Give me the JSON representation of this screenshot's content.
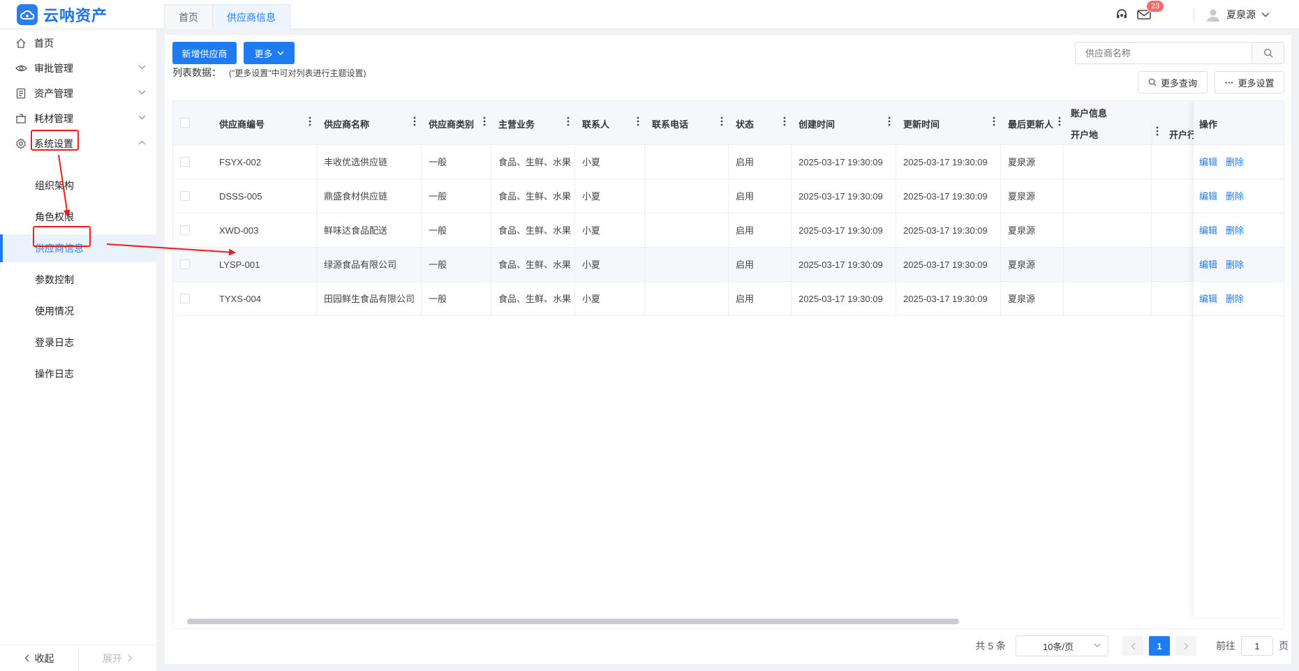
{
  "app": {
    "name": "云呐资产"
  },
  "tabs": [
    {
      "label": "首页"
    },
    {
      "label": "供应商信息"
    }
  ],
  "header": {
    "badge_count": "23",
    "username": "夏泉源"
  },
  "sidebar": {
    "items": [
      {
        "label": "首页",
        "icon": "home-icon"
      },
      {
        "label": "审批管理",
        "icon": "eye-icon"
      },
      {
        "label": "资产管理",
        "icon": "document-icon"
      },
      {
        "label": "耗材管理",
        "icon": "box-icon"
      },
      {
        "label": "系统设置",
        "icon": "gear-icon"
      }
    ],
    "sub_items": [
      {
        "label": "组织架构"
      },
      {
        "label": "角色权限"
      },
      {
        "label": "供应商信息"
      },
      {
        "label": "参数控制"
      },
      {
        "label": "使用情况"
      },
      {
        "label": "登录日志"
      },
      {
        "label": "操作日志"
      }
    ],
    "collapse_label": "收起",
    "expand_label": "展开"
  },
  "toolbar": {
    "add_label": "新增供应商",
    "more_label": "更多"
  },
  "search": {
    "placeholder": "供应商名称"
  },
  "list": {
    "label": "列表数据：",
    "hint": "(\"更多设置\"中可对列表进行主题设置)",
    "more_query": "更多查询",
    "more_settings": "更多设置"
  },
  "table": {
    "columns": [
      "供应商编号",
      "供应商名称",
      "供应商类别",
      "主营业务",
      "联系人",
      "联系电话",
      "状态",
      "创建时间",
      "更新时间",
      "最后更新人"
    ],
    "account_group": "账户信息",
    "account_sub": [
      "开户地",
      "开户行"
    ],
    "ops_header": "操作",
    "edit_label": "编辑",
    "delete_label": "删除",
    "rows": [
      {
        "code": "FSYX-002",
        "name": "丰收优选供应链",
        "category": "一般",
        "business": "食品、生鲜、水果",
        "contact": "小夏",
        "phone": "",
        "status": "启用",
        "created": "2025-03-17 19:30:09",
        "updated": "2025-03-17 19:30:09",
        "updater": "夏泉源"
      },
      {
        "code": "DSSS-005",
        "name": "鼎盛食材供应链",
        "category": "一般",
        "business": "食品、生鲜、水果",
        "contact": "小夏",
        "phone": "",
        "status": "启用",
        "created": "2025-03-17 19:30:09",
        "updated": "2025-03-17 19:30:09",
        "updater": "夏泉源"
      },
      {
        "code": "XWD-003",
        "name": "鲜味达食品配送",
        "category": "一般",
        "business": "食品、生鲜、水果",
        "contact": "小夏",
        "phone": "",
        "status": "启用",
        "created": "2025-03-17 19:30:09",
        "updated": "2025-03-17 19:30:09",
        "updater": "夏泉源"
      },
      {
        "code": "LYSP-001",
        "name": "绿源食品有限公司",
        "category": "一般",
        "business": "食品、生鲜、水果",
        "contact": "小夏",
        "phone": "",
        "status": "启用",
        "created": "2025-03-17 19:30:09",
        "updated": "2025-03-17 19:30:09",
        "updater": "夏泉源"
      },
      {
        "code": "TYXS-004",
        "name": "田园鲜生食品有限公司",
        "category": "一般",
        "business": "食品、生鲜、水果",
        "contact": "小夏",
        "phone": "",
        "status": "启用",
        "created": "2025-03-17 19:30:09",
        "updated": "2025-03-17 19:30:09",
        "updater": "夏泉源"
      }
    ]
  },
  "pagination": {
    "total": "共 5 条",
    "page_size": "10条/页",
    "current_page": "1",
    "goto_label": "前往",
    "goto_value": "1",
    "page_suffix": "页"
  },
  "colors": {
    "primary": "#1e7bf0",
    "badge": "#f56c6c",
    "annotation": "#f01a1a"
  }
}
